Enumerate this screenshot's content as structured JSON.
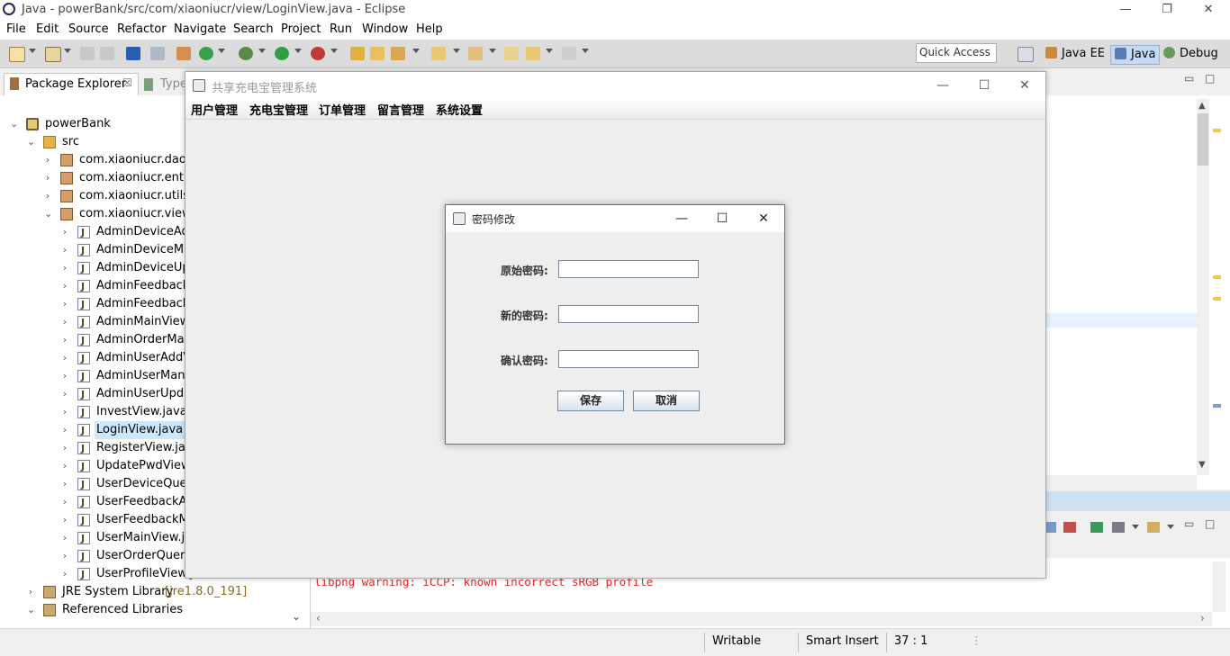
{
  "window": {
    "title": "Java - powerBank/src/com/xiaoniucr/view/LoginView.java - Eclipse",
    "minimize": "—",
    "restore": "❐",
    "close": "✕"
  },
  "menu": [
    "File",
    "Edit",
    "Source",
    "Refactor",
    "Navigate",
    "Search",
    "Project",
    "Run",
    "Window",
    "Help"
  ],
  "toolbar": {
    "quick_access": "Quick Access",
    "perspectives": [
      "Java EE",
      "Java",
      "Debug"
    ]
  },
  "package_explorer": {
    "tab_label": "Package Explorer",
    "tab_close": "☒",
    "second_tab": "Type",
    "items": [
      {
        "label": "powerBank",
        "indent": 0,
        "chevron": "down",
        "icon": "project"
      },
      {
        "label": "src",
        "indent": 1,
        "chevron": "down",
        "icon": "source-folder"
      },
      {
        "label": "com.xiaoniucr.dao",
        "indent": 2,
        "chevron": "right",
        "icon": "package"
      },
      {
        "label": "com.xiaoniucr.entity",
        "indent": 2,
        "chevron": "right",
        "icon": "package"
      },
      {
        "label": "com.xiaoniucr.utils",
        "indent": 2,
        "chevron": "right",
        "icon": "package"
      },
      {
        "label": "com.xiaoniucr.view",
        "indent": 2,
        "chevron": "down",
        "icon": "package"
      },
      {
        "label": "AdminDeviceAdd",
        "indent": 3,
        "chevron": "right",
        "icon": "java"
      },
      {
        "label": "AdminDeviceMan",
        "indent": 3,
        "chevron": "right",
        "icon": "java"
      },
      {
        "label": "AdminDeviceUpd",
        "indent": 3,
        "chevron": "right",
        "icon": "java"
      },
      {
        "label": "AdminFeedbackM",
        "indent": 3,
        "chevron": "right",
        "icon": "java"
      },
      {
        "label": "AdminFeedbackR",
        "indent": 3,
        "chevron": "right",
        "icon": "java"
      },
      {
        "label": "AdminMainView.j",
        "indent": 3,
        "chevron": "right",
        "icon": "java"
      },
      {
        "label": "AdminOrderMana",
        "indent": 3,
        "chevron": "right",
        "icon": "java"
      },
      {
        "label": "AdminUserAddVi",
        "indent": 3,
        "chevron": "right",
        "icon": "java"
      },
      {
        "label": "AdminUserManag",
        "indent": 3,
        "chevron": "right",
        "icon": "java"
      },
      {
        "label": "AdminUserUpdat",
        "indent": 3,
        "chevron": "right",
        "icon": "java"
      },
      {
        "label": "InvestView.java",
        "indent": 3,
        "chevron": "right",
        "icon": "java"
      },
      {
        "label": "LoginView.java",
        "indent": 3,
        "chevron": "right",
        "icon": "java",
        "selected": true
      },
      {
        "label": "RegisterView.java",
        "indent": 3,
        "chevron": "right",
        "icon": "java"
      },
      {
        "label": "UpdatePwdView.j",
        "indent": 3,
        "chevron": "right",
        "icon": "java"
      },
      {
        "label": "UserDeviceQuery",
        "indent": 3,
        "chevron": "right",
        "icon": "java"
      },
      {
        "label": "UserFeedbackAd",
        "indent": 3,
        "chevron": "right",
        "icon": "java"
      },
      {
        "label": "UserFeedbackMa",
        "indent": 3,
        "chevron": "right",
        "icon": "java"
      },
      {
        "label": "UserMainView.jav",
        "indent": 3,
        "chevron": "right",
        "icon": "java"
      },
      {
        "label": "UserOrderQueryV",
        "indent": 3,
        "chevron": "right",
        "icon": "java"
      },
      {
        "label": "UserProfileView.java",
        "indent": 3,
        "chevron": "right",
        "icon": "java"
      },
      {
        "label": "JRE System Library",
        "suffix": "[jre1.8.0_191]",
        "indent": 1,
        "chevron": "right",
        "icon": "library"
      },
      {
        "label": "Referenced Libraries",
        "indent": 1,
        "chevron": "down",
        "icon": "library"
      }
    ]
  },
  "console": {
    "text": "libpng warning: iCCP: known incorrect sRGB profile",
    "text_color": "#e02a2a"
  },
  "statusbar": {
    "writable": "Writable",
    "insert_mode": "Smart Insert",
    "position": "37 : 1"
  },
  "main_frame": {
    "title": "共享充电宝管理系统",
    "menu": [
      "用户管理",
      "充电宝管理",
      "订单管理",
      "留言管理",
      "系统设置"
    ]
  },
  "dialog": {
    "title": "密码修改",
    "fields": [
      {
        "label": "原始密码:",
        "value": ""
      },
      {
        "label": "新的密码:",
        "value": ""
      },
      {
        "label": "确认密码:",
        "value": ""
      }
    ],
    "save_label": "保存",
    "cancel_label": "取消"
  },
  "colors": {
    "selection": "#cce8ff",
    "toolbar_bg": "#dcdcdc",
    "status_bar_blue": "#cfe0f0"
  }
}
